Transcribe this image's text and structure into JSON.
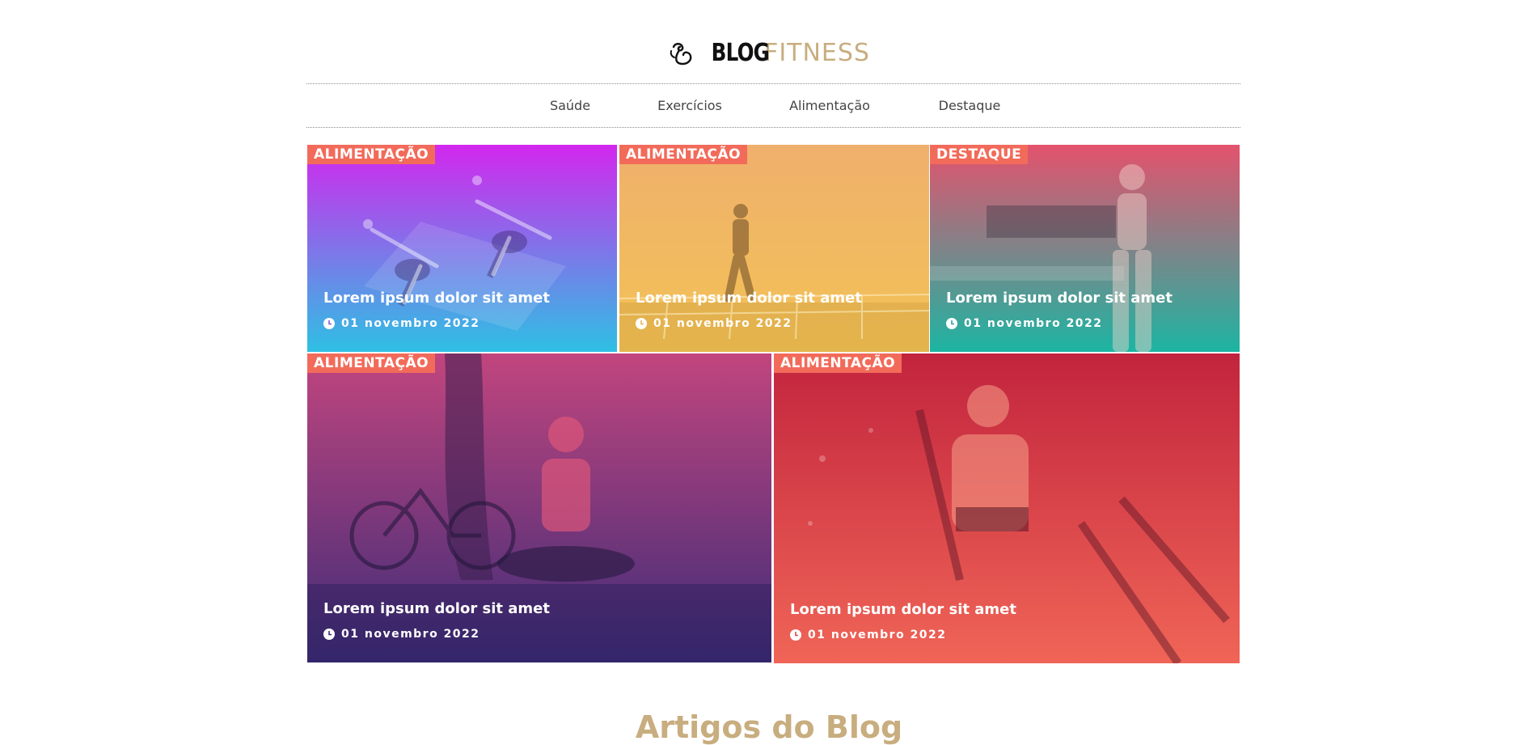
{
  "brand": {
    "part1": "BLOG",
    "part2": "FITNESS",
    "accent_color": "#c8ad7f",
    "icon": "bicep-flex-icon"
  },
  "nav": {
    "items": [
      {
        "label": "Saúde"
      },
      {
        "label": "Exercícios"
      },
      {
        "label": "Alimentação"
      },
      {
        "label": "Destaque"
      }
    ]
  },
  "posts": [
    {
      "category": "ALIMENTAÇÃO",
      "title": "Lorem ipsum dolor sit amet",
      "date": "01 novembro 2022",
      "gradient": [
        "#d327ee",
        "#2ec0e4"
      ],
      "photo": "yoga-pose"
    },
    {
      "category": "ALIMENTAÇÃO",
      "title": "Lorem ipsum dolor sit amet",
      "date": "01 novembro 2022",
      "gradient": [
        "#efb06c",
        "#f3c256"
      ],
      "photo": "woman-running"
    },
    {
      "category": "DESTAQUE",
      "title": "Lorem ipsum dolor sit amet",
      "date": "01 novembro 2022",
      "gradient": [
        "#e4526d",
        "#1cb5a3"
      ],
      "photo": "woman-in-kitchen"
    },
    {
      "category": "ALIMENTAÇÃO",
      "title": "Lorem ipsum dolor sit amet",
      "date": "01 novembro 2022",
      "gradient": [
        "#c2457e",
        "#3d2c78"
      ],
      "photo": "woman-with-bicycle"
    },
    {
      "category": "ALIMENTAÇÃO",
      "title": "Lorem ipsum dolor sit amet",
      "date": "01 novembro 2022",
      "gradient": [
        "#c2243d",
        "#f06557"
      ],
      "photo": "woman-elliptical"
    }
  ],
  "badge_color": "#f26b5a",
  "section": {
    "title": "Artigos do Blog"
  }
}
